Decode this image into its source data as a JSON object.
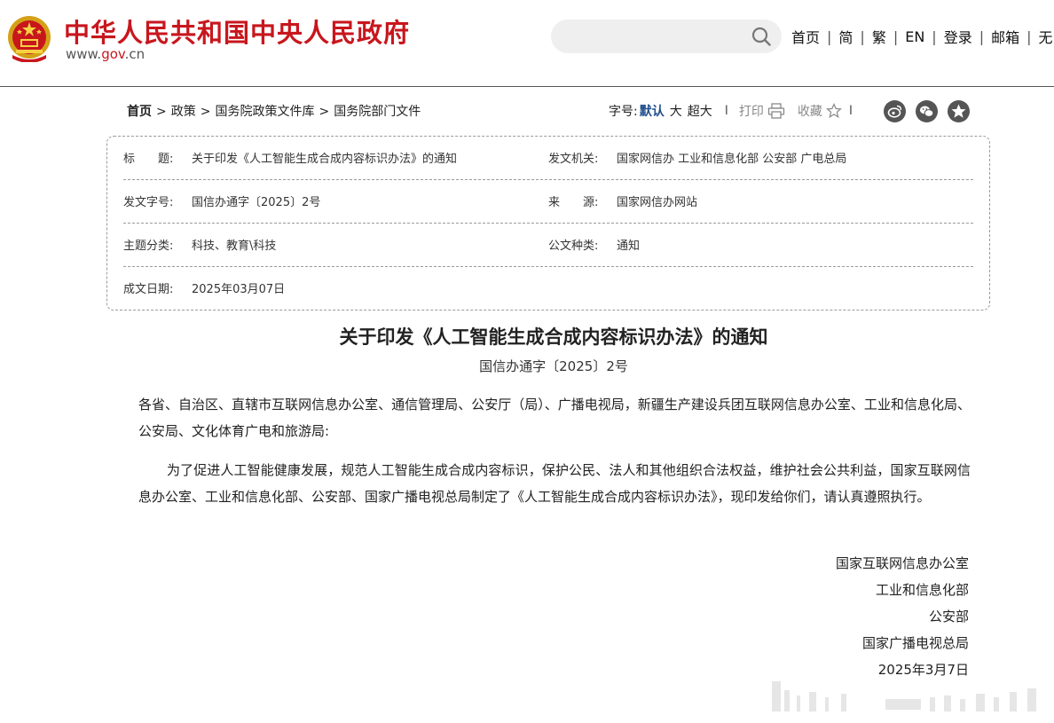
{
  "header": {
    "site_title": "中华人民共和国中央人民政府",
    "site_url_prefix": "www.",
    "site_url_gov": "gov",
    "site_url_suffix": ".cn",
    "search_placeholder": "",
    "nav": [
      "首页",
      "简",
      "繁",
      "EN",
      "登录",
      "邮箱",
      "无"
    ],
    "nav_separator": "|"
  },
  "breadcrumb": {
    "items": [
      "首页",
      "政策",
      "国务院政策文件库",
      "国务院部门文件"
    ],
    "separator": ">"
  },
  "tools": {
    "font_size_label": "字号:",
    "font_default": "默认",
    "font_large": "大",
    "font_xlarge": "超大",
    "separator": "I",
    "print_label": "打印",
    "favorite_label": "收藏",
    "share_icons": [
      "weibo-icon",
      "wechat-icon",
      "qzone-star-icon"
    ]
  },
  "info": {
    "title_label": "标　　题:",
    "title_value": "关于印发《人工智能生成合成内容标识办法》的通知",
    "issuer_label": "发文机关:",
    "issuer_value": "国家网信办 工业和信息化部 公安部 广电总局",
    "docno_label": "发文字号:",
    "docno_value": "国信办通字〔2025〕2号",
    "source_label": "来　　源:",
    "source_value": "国家网信办网站",
    "topic_label": "主题分类:",
    "topic_value": "科技、教育\\科技",
    "type_label": "公文种类:",
    "type_value": "通知",
    "date_label": "成文日期:",
    "date_value": "2025年03月07日"
  },
  "article": {
    "title": "关于印发《人工智能生成合成内容标识办法》的通知",
    "doc_number": "国信办通字〔2025〕2号",
    "addressee": "各省、自治区、直辖市互联网信息办公室、通信管理局、公安厅（局）、广播电视局，新疆生产建设兵团互联网信息办公室、工业和信息化局、公安局、文化体育广电和旅游局:",
    "body": "为了促进人工智能健康发展，规范人工智能生成合成内容标识，保护公民、法人和其他组织合法权益，维护社会公共利益，国家互联网信息办公室、工业和信息化部、公安部、国家广播电视总局制定了《人工智能生成合成内容标识办法》，现印发给你们，请认真遵照执行。",
    "signatories": [
      "国家互联网信息办公室",
      "工业和信息化部",
      "公安部",
      "国家广播电视总局"
    ],
    "sign_date": "2025年3月7日"
  },
  "colors": {
    "brand_red": "#c8161d",
    "link_blue": "#1f4e8c",
    "border_gray": "#9a9a9a"
  }
}
